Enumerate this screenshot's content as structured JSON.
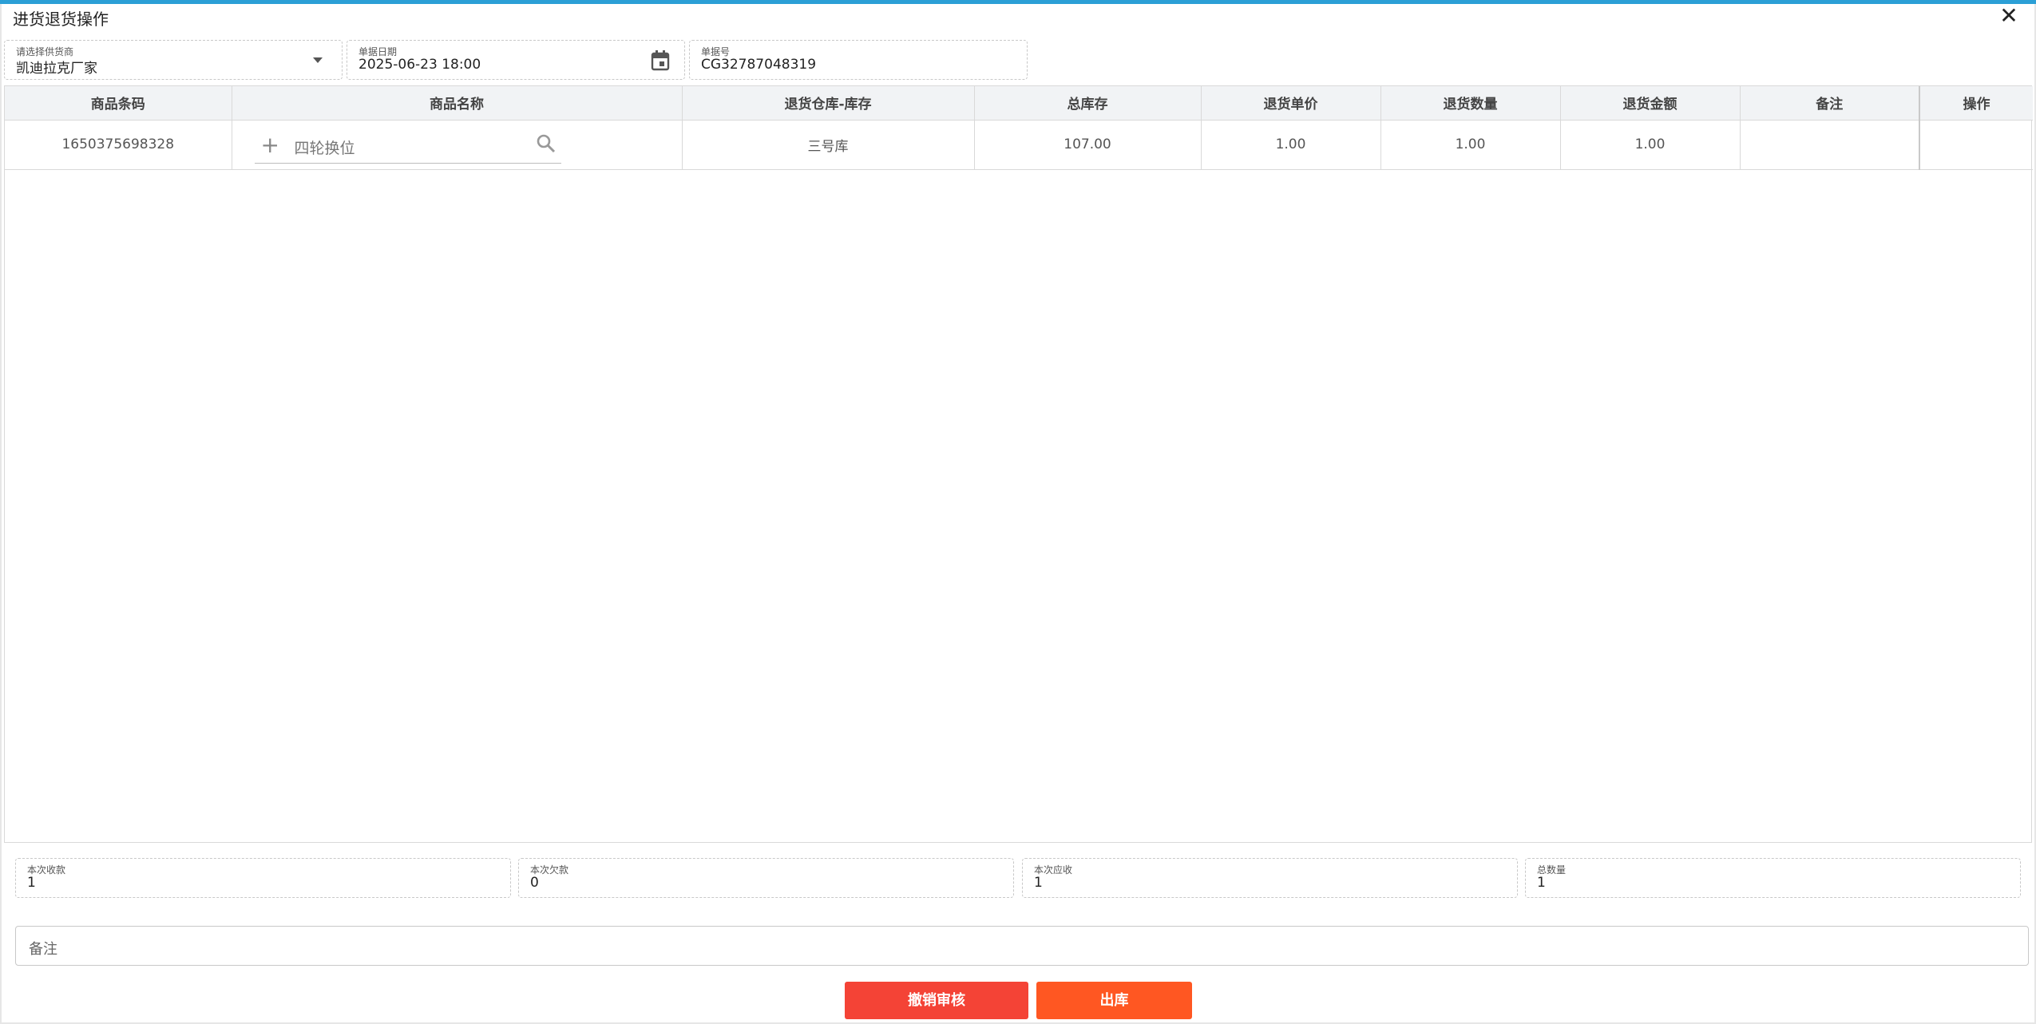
{
  "dialog": {
    "title": "进货退货操作"
  },
  "header": {
    "supplier": {
      "label": "请选择供货商",
      "value": "凯迪拉克厂家"
    },
    "date": {
      "label": "单据日期",
      "value": "2025-06-23 18:00"
    },
    "doc_no": {
      "label": "单据号",
      "value": "CG32787048319"
    }
  },
  "table": {
    "columns": [
      "商品条码",
      "商品名称",
      "退货仓库-库存",
      "总库存",
      "退货单价",
      "退货数量",
      "退货金额",
      "备注",
      "操作"
    ],
    "rows": [
      {
        "barcode": "1650375698328",
        "name_placeholder": "四轮换位",
        "warehouse": "三号库",
        "total_stock": "107.00",
        "unit_price": "1.00",
        "quantity": "1.00",
        "amount": "1.00",
        "note": "",
        "action": ""
      }
    ]
  },
  "summary": {
    "received": {
      "label": "本次收款",
      "value": "1"
    },
    "owed": {
      "label": "本次欠款",
      "value": "0"
    },
    "receivable": {
      "label": "本次应收",
      "value": "1"
    },
    "total_qty": {
      "label": "总数量",
      "value": "1"
    }
  },
  "remark": {
    "placeholder": "备注"
  },
  "buttons": {
    "revoke": "撤销审核",
    "outbound": "出库"
  },
  "colors": {
    "accent": "#2b9fd6",
    "revoke_button": "#f44336",
    "outbound_button": "#ff5722"
  }
}
